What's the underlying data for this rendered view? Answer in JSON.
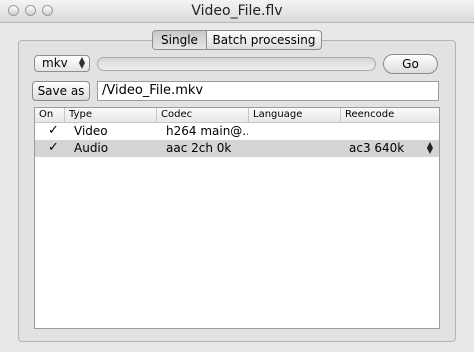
{
  "window": {
    "title": "Video_File.flv"
  },
  "tabs": {
    "single": "Single",
    "batch": "Batch processing"
  },
  "toolbar": {
    "format": "mkv",
    "go": "Go",
    "save_as": "Save as",
    "output_path": "/Video_File.mkv"
  },
  "table": {
    "headers": [
      "On",
      "Type",
      "Codec",
      "Language",
      "Reencode"
    ],
    "rows": [
      {
        "checked": "✓",
        "type": "Video",
        "codec": "h264 main@...",
        "language": "",
        "reencode": ""
      },
      {
        "checked": "✓",
        "type": "Audio",
        "codec": "aac 2ch 0k",
        "language": "",
        "reencode": "ac3 640k"
      }
    ]
  },
  "icons": {
    "close": "close-button-icon",
    "minimize": "minimize-button-icon",
    "zoom": "zoom-button-icon",
    "popup_arrows": "chevron-updown-icon",
    "checkbox": "checkmark-icon",
    "stepper": "stepper-arrows-icon"
  }
}
